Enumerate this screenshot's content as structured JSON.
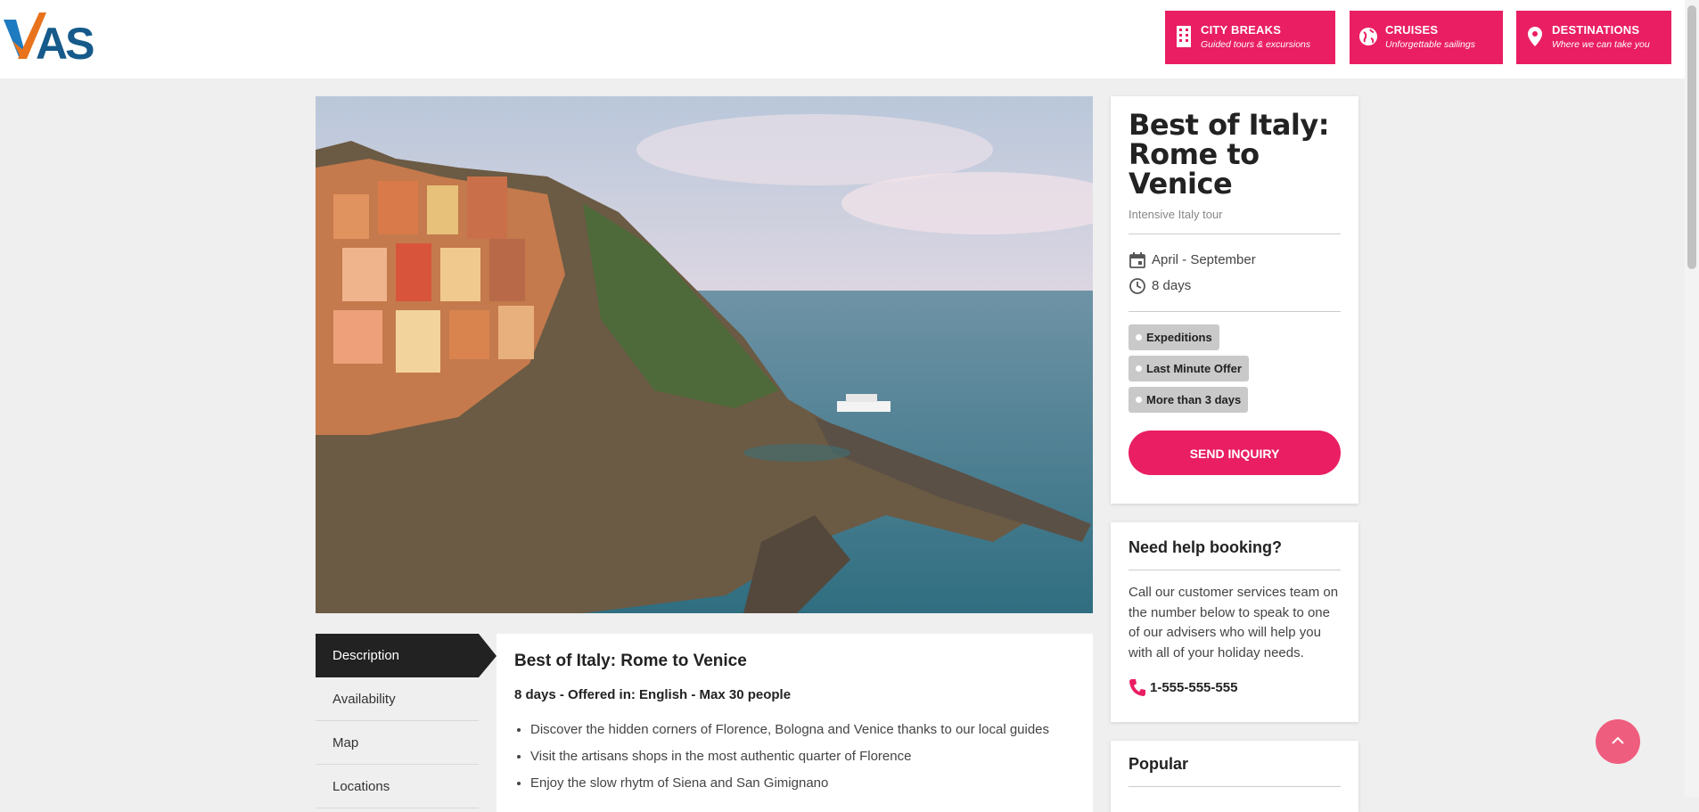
{
  "header": {
    "nav": [
      {
        "title": "CITY BREAKS",
        "subtitle": "Guided tours & excursions",
        "icon": "building-icon"
      },
      {
        "title": "CRUISES",
        "subtitle": "Unforgettable sailings",
        "icon": "globe-icon"
      },
      {
        "title": "DESTINATIONS",
        "subtitle": "Where we can take you",
        "icon": "location-pin-icon"
      }
    ],
    "logo_text": "VAS"
  },
  "tour": {
    "title": "Best of Italy: Rome to Venice",
    "subtitle": "Intensive Italy tour",
    "season": "April - September",
    "duration": "8 days",
    "tags": [
      "Expeditions",
      "Last Minute Offer",
      "More than 3 days"
    ],
    "inquiry_label": "SEND INQUIRY"
  },
  "help": {
    "title": "Need help booking?",
    "text": "Call our customer services team on the number below to speak to one of our advisers who will help you with all of your holiday needs.",
    "phone": "1-555-555-555"
  },
  "popular": {
    "title": "Popular"
  },
  "tabs": [
    "Description",
    "Availability",
    "Map",
    "Locations"
  ],
  "description": {
    "heading": "Best of Italy: Rome to Venice",
    "info": "8 days - Offered in: English - Max 30 people",
    "bullets": [
      "Discover the hidden corners of Florence, Bologna and Venice thanks to our local guides",
      "Visit the artisans shops in the most authentic quarter of Florence",
      "Enjoy the slow rhytm of Siena and San Gimignano"
    ]
  },
  "colors": {
    "accent": "#e91e63",
    "dark": "#222222",
    "background": "#efefef"
  }
}
